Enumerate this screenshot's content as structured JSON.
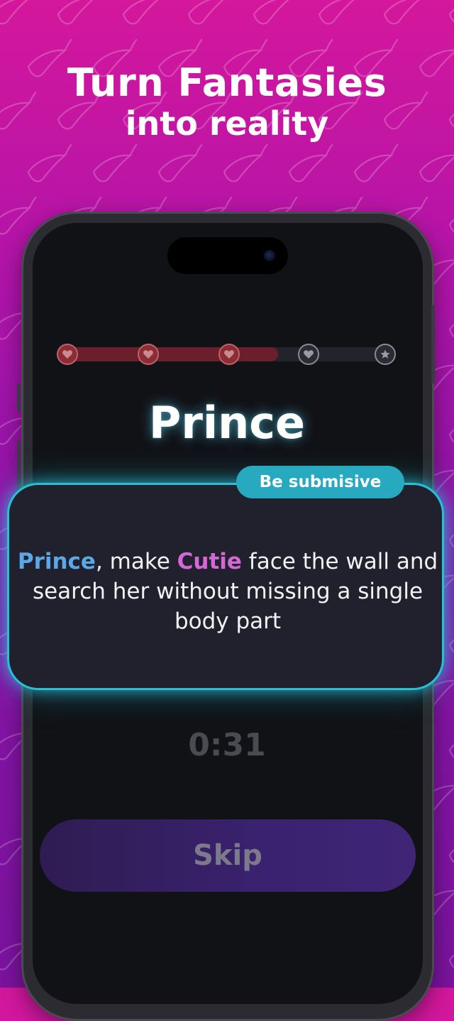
{
  "headline": {
    "line1": "Turn Fantasies",
    "line2": "into reality"
  },
  "game": {
    "progress": {
      "completed_steps": 3,
      "total_steps": 5,
      "fill_fraction": 0.66,
      "step_icons": [
        "heart-icon",
        "heart-icon",
        "heart-icon",
        "heart-icon",
        "star-icon"
      ]
    },
    "current_player": "Prince",
    "card": {
      "badge": "Be submisive",
      "actor": "Prince",
      "segment1": ", make ",
      "target": "Cutie",
      "segment2": " face the wall and search her without missing a single body part"
    },
    "timer": "0:31",
    "skip_label": "Skip"
  },
  "colors": {
    "background_top": "#d4179c",
    "background_bottom": "#7a139e",
    "card_glow": "#27c1d6",
    "badge_bg": "#27a9bf",
    "actor_name": "#5aa8e6",
    "target_name": "#d468d6",
    "progress_fill": "#6b1f2a"
  }
}
